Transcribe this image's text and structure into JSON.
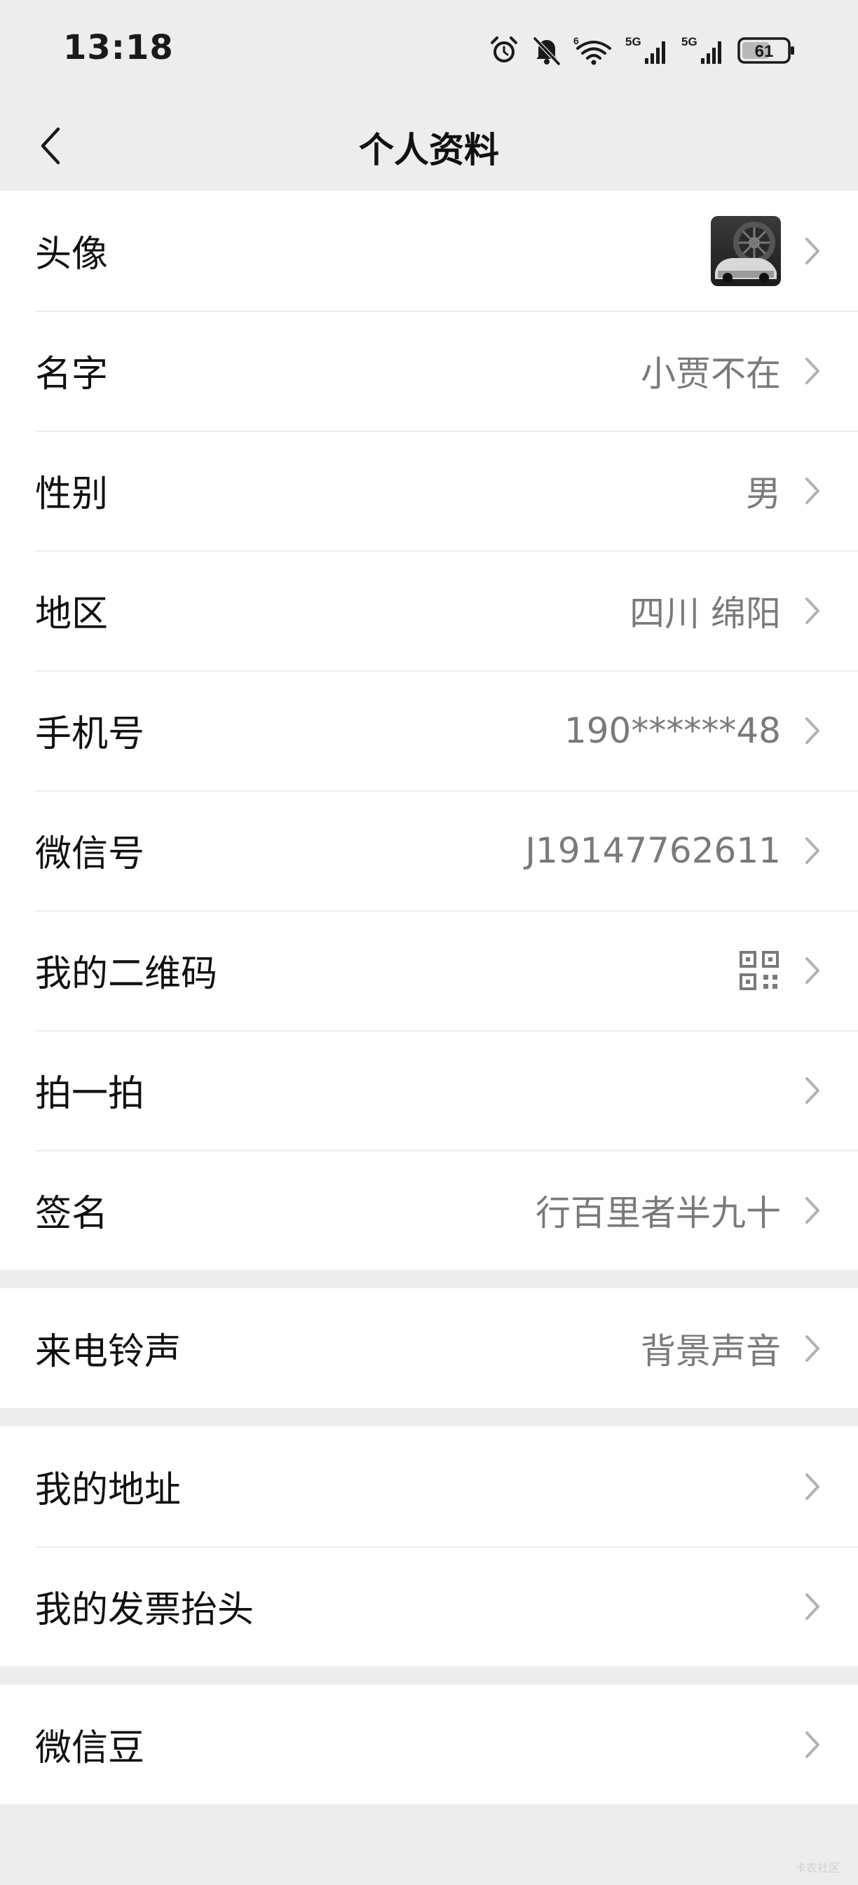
{
  "status_bar": {
    "time": "13:18",
    "battery": "61",
    "network_1": "5G",
    "network_2": "5G",
    "wifi_badge": "6",
    "icons": [
      "alarm-icon",
      "bell-muted-icon",
      "wifi-icon",
      "signal-icon",
      "signal-icon",
      "battery-icon"
    ]
  },
  "nav": {
    "title": "个人资料",
    "back_icon": "chevron-left-icon"
  },
  "group1": {
    "avatar_label": "头像",
    "name_label": "名字",
    "name_value": "小贾不在",
    "gender_label": "性别",
    "gender_value": "男",
    "region_label": "地区",
    "region_value": "四川 绵阳",
    "phone_label": "手机号",
    "phone_value": "190******48",
    "wechat_id_label": "微信号",
    "wechat_id_value": "J19147762611",
    "qrcode_label": "我的二维码",
    "pat_label": "拍一拍",
    "signature_label": "签名",
    "signature_value": "行百里者半九十"
  },
  "group2": {
    "ringtone_label": "来电铃声",
    "ringtone_value": "背景声音"
  },
  "group3": {
    "address_label": "我的地址",
    "invoice_label": "我的发票抬头"
  },
  "group4": {
    "beans_label": "微信豆"
  },
  "watermark": "卡农社区",
  "colors": {
    "background": "#ededed",
    "row_background": "#ffffff",
    "label_text": "#111111",
    "value_text": "#7a7a7a",
    "chevron": "#b2b2b2",
    "divider": "#ececec"
  }
}
